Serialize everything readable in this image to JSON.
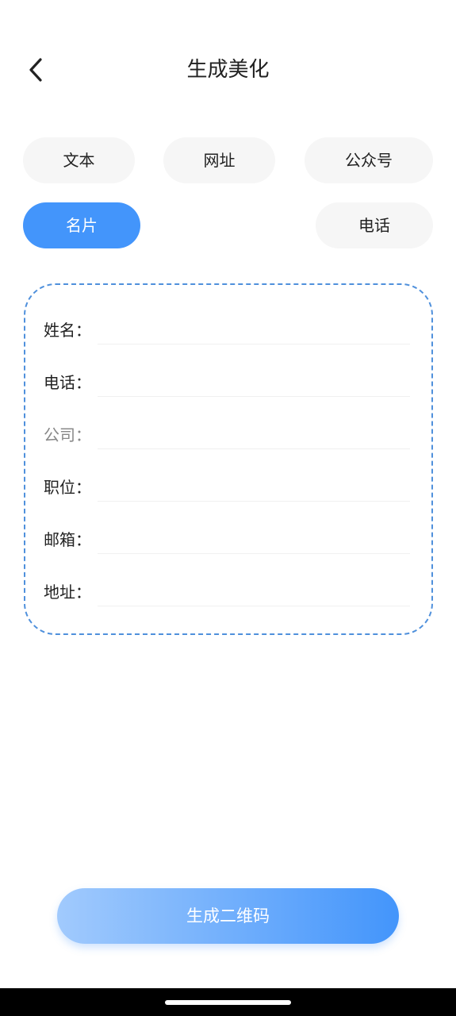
{
  "header": {
    "title": "生成美化",
    "back_icon": "chevron-left-icon"
  },
  "tabs": [
    {
      "id": "text",
      "label": "文本",
      "active": false
    },
    {
      "id": "url",
      "label": "网址",
      "active": false
    },
    {
      "id": "official",
      "label": "公众号",
      "active": false
    },
    {
      "id": "card",
      "label": "名片",
      "active": true
    },
    {
      "id": "phone",
      "label": "电话",
      "active": false
    }
  ],
  "form": {
    "fields": [
      {
        "label": "姓名：",
        "value": ""
      },
      {
        "label": "电话：",
        "value": ""
      },
      {
        "label": "公司：",
        "value": ""
      },
      {
        "label": "职位：",
        "value": ""
      },
      {
        "label": "邮箱：",
        "value": ""
      },
      {
        "label": "地址：",
        "value": ""
      }
    ],
    "border_color": "#4f90dc"
  },
  "actions": {
    "generate_label": "生成二维码"
  },
  "colors": {
    "accent": "#4395fb",
    "tab_bg": "#f6f6f6",
    "text": "#222222"
  }
}
